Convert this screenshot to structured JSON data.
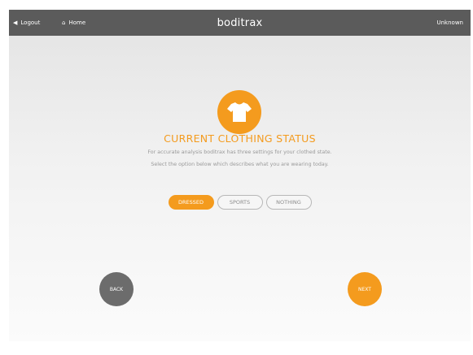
{
  "topbar": {
    "logout_label": "Logout",
    "logout_icon": "◀",
    "home_label": "Home",
    "home_icon": "⌂",
    "brand": "boditrax",
    "user": "Unknown"
  },
  "main": {
    "icon": "tshirt-icon",
    "title": "CURRENT CLOTHING STATUS",
    "description_line1": "For accurate analysis boditrax has three settings for your clothed state.",
    "description_line2": "Select the option below which describes what you are wearing today.",
    "options": [
      {
        "label": "DRESSED",
        "selected": true
      },
      {
        "label": "SPORTS",
        "selected": false
      },
      {
        "label": "NOTHING",
        "selected": false
      }
    ]
  },
  "footer": {
    "back_label": "BACK",
    "next_label": "NEXT"
  },
  "colors": {
    "accent": "#f49b1e",
    "topbar": "#5b5b5b",
    "back_button": "#6c6c6c"
  }
}
